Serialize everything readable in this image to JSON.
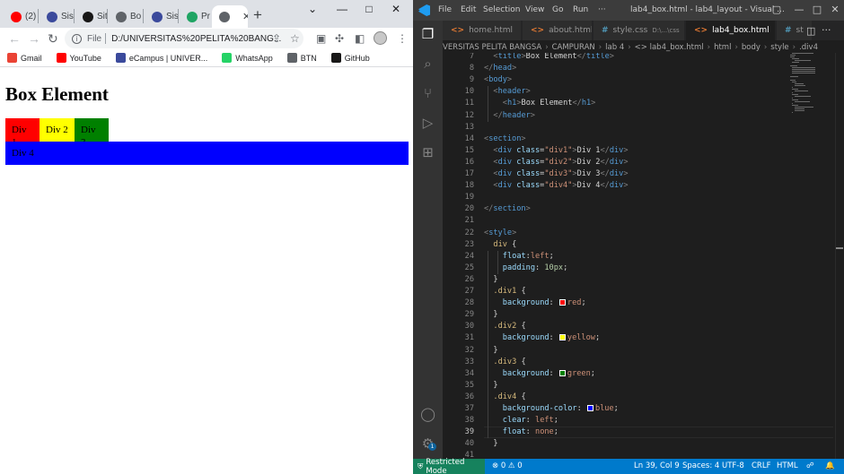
{
  "browser": {
    "tabs": [
      {
        "label": "(2)",
        "icon": "youtube-icon",
        "color": "#ff0000"
      },
      {
        "label": "Sis",
        "icon": "campus-icon",
        "color": "#3b4a9c"
      },
      {
        "label": "Sit",
        "icon": "github-icon",
        "color": "#181717"
      },
      {
        "label": "Bo",
        "icon": "globe-icon",
        "color": "#5f6368"
      },
      {
        "label": "Sis",
        "icon": "campus-icon",
        "color": "#3b4a9c"
      },
      {
        "label": "Pra",
        "icon": "drive-icon",
        "color": "#1fa463"
      },
      {
        "label": "",
        "icon": "globe-icon",
        "color": "#5f6368"
      }
    ],
    "new_tab": "+",
    "window_controls": {
      "minimize": "—",
      "maximize": "□",
      "close": "✕",
      "dropdown": "⌄"
    },
    "nav": {
      "back": "←",
      "forward": "→",
      "reload": "↻"
    },
    "address": {
      "scheme": "File",
      "url": "D:/UNIVERSITAS%20PELITA%20BANG..."
    },
    "bookmarks": [
      {
        "label": "Gmail",
        "icon": "gmail-icon",
        "color": "#ea4335"
      },
      {
        "label": "YouTube",
        "icon": "youtube-icon",
        "color": "#ff0000"
      },
      {
        "label": "eCampus | UNIVER...",
        "icon": "campus-icon",
        "color": "#3b4a9c"
      },
      {
        "label": "WhatsApp",
        "icon": "whatsapp-icon",
        "color": "#25d366"
      },
      {
        "label": "BTN",
        "icon": "globe-icon",
        "color": "#5f6368"
      },
      {
        "label": "GitHub",
        "icon": "github-icon",
        "color": "#181717"
      }
    ],
    "page": {
      "heading": "Box Element",
      "divs": [
        {
          "label": "Div 1",
          "color": "#ff0000"
        },
        {
          "label": "Div 2",
          "color": "#ffff00"
        },
        {
          "label": "Div 3",
          "color": "#008000"
        },
        {
          "label": "Div 4",
          "color": "#0000ff"
        }
      ]
    }
  },
  "vscode": {
    "menu": [
      "File",
      "Edit",
      "Selection",
      "View",
      "Go",
      "Run",
      "···"
    ],
    "title": "lab4_box.html - lab4_layout - Visual ...",
    "window_controls": {
      "layout": "▢",
      "minimize": "—",
      "maximize": "□",
      "close": "✕"
    },
    "tabs": [
      {
        "icon": "<>",
        "kind": "html",
        "label": "home.html",
        "desc": ""
      },
      {
        "icon": "<>",
        "kind": "html",
        "label": "about.html",
        "desc": ""
      },
      {
        "icon": "#",
        "kind": "css",
        "label": "style.css",
        "desc": "D:\\...\\css"
      },
      {
        "icon": "<>",
        "kind": "html",
        "label": "lab4_box.html",
        "desc": "",
        "active": true
      },
      {
        "icon": "#",
        "kind": "css",
        "label": "st",
        "desc": ""
      }
    ],
    "breadcrumb": [
      "VERSITAS PELITA BANGSA",
      "CAMPURAN",
      "lab 4",
      "<> lab4_box.html",
      "html",
      "body",
      "style",
      ".div4"
    ],
    "code": {
      "current_line": 39,
      "lines": [
        {
          "n": 7,
          "indent": 2,
          "tokens": [
            [
              "br",
              "<"
            ],
            [
              "tg",
              "title"
            ],
            [
              "br",
              ">"
            ],
            [
              "tx",
              "Box Element"
            ],
            [
              "br",
              "</"
            ],
            [
              "tg",
              "title"
            ],
            [
              "br",
              ">"
            ]
          ]
        },
        {
          "n": 8,
          "indent": 0,
          "tokens": [
            [
              "br",
              "</"
            ],
            [
              "tg",
              "head"
            ],
            [
              "br",
              ">"
            ]
          ]
        },
        {
          "n": 9,
          "indent": 0,
          "tokens": [
            [
              "br",
              "<"
            ],
            [
              "tg",
              "body"
            ],
            [
              "br",
              ">"
            ]
          ]
        },
        {
          "n": 10,
          "indent": 2,
          "tokens": [
            [
              "br",
              "<"
            ],
            [
              "tg",
              "header"
            ],
            [
              "br",
              ">"
            ]
          ]
        },
        {
          "n": 11,
          "indent": 4,
          "tokens": [
            [
              "br",
              "<"
            ],
            [
              "tg",
              "h1"
            ],
            [
              "br",
              ">"
            ],
            [
              "tx",
              "Box Element"
            ],
            [
              "br",
              "</"
            ],
            [
              "tg",
              "h1"
            ],
            [
              "br",
              ">"
            ]
          ]
        },
        {
          "n": 12,
          "indent": 2,
          "tokens": [
            [
              "br",
              "</"
            ],
            [
              "tg",
              "header"
            ],
            [
              "br",
              ">"
            ]
          ]
        },
        {
          "n": 13,
          "indent": 0,
          "tokens": []
        },
        {
          "n": 14,
          "indent": 0,
          "tokens": [
            [
              "br",
              "<"
            ],
            [
              "tg",
              "section"
            ],
            [
              "br",
              ">"
            ]
          ]
        },
        {
          "n": 15,
          "indent": 2,
          "tokens": [
            [
              "br",
              "<"
            ],
            [
              "tg",
              "div"
            ],
            [
              "tx",
              " "
            ],
            [
              "at",
              "class"
            ],
            [
              "tx",
              "="
            ],
            [
              "sv",
              "\"div1\""
            ],
            [
              "br",
              ">"
            ],
            [
              "tx",
              "Div 1"
            ],
            [
              "br",
              "</"
            ],
            [
              "tg",
              "div"
            ],
            [
              "br",
              ">"
            ]
          ]
        },
        {
          "n": 16,
          "indent": 2,
          "tokens": [
            [
              "br",
              "<"
            ],
            [
              "tg",
              "div"
            ],
            [
              "tx",
              " "
            ],
            [
              "at",
              "class"
            ],
            [
              "tx",
              "="
            ],
            [
              "sv",
              "\"div2\""
            ],
            [
              "br",
              ">"
            ],
            [
              "tx",
              "Div 2"
            ],
            [
              "br",
              "</"
            ],
            [
              "tg",
              "div"
            ],
            [
              "br",
              ">"
            ]
          ]
        },
        {
          "n": 17,
          "indent": 2,
          "tokens": [
            [
              "br",
              "<"
            ],
            [
              "tg",
              "div"
            ],
            [
              "tx",
              " "
            ],
            [
              "at",
              "class"
            ],
            [
              "tx",
              "="
            ],
            [
              "sv",
              "\"div3\""
            ],
            [
              "br",
              ">"
            ],
            [
              "tx",
              "Div 3"
            ],
            [
              "br",
              "</"
            ],
            [
              "tg",
              "div"
            ],
            [
              "br",
              ">"
            ]
          ]
        },
        {
          "n": 18,
          "indent": 2,
          "tokens": [
            [
              "br",
              "<"
            ],
            [
              "tg",
              "div"
            ],
            [
              "tx",
              " "
            ],
            [
              "at",
              "class"
            ],
            [
              "tx",
              "="
            ],
            [
              "sv",
              "\"div4\""
            ],
            [
              "br",
              ">"
            ],
            [
              "tx",
              "Div 4"
            ],
            [
              "br",
              "</"
            ],
            [
              "tg",
              "div"
            ],
            [
              "br",
              ">"
            ]
          ]
        },
        {
          "n": 19,
          "indent": 0,
          "tokens": []
        },
        {
          "n": 20,
          "indent": 0,
          "tokens": [
            [
              "br",
              "</"
            ],
            [
              "tg",
              "section"
            ],
            [
              "br",
              ">"
            ]
          ]
        },
        {
          "n": 21,
          "indent": 0,
          "tokens": []
        },
        {
          "n": 22,
          "indent": 0,
          "tokens": [
            [
              "br",
              "<"
            ],
            [
              "tg",
              "style"
            ],
            [
              "br",
              ">"
            ]
          ]
        },
        {
          "n": 23,
          "indent": 2,
          "tokens": [
            [
              "sel",
              "div"
            ],
            [
              "tx",
              " {"
            ]
          ]
        },
        {
          "n": 24,
          "indent": 4,
          "tokens": [
            [
              "pr",
              "float"
            ],
            [
              "tx",
              ":"
            ],
            [
              "vv",
              "left"
            ],
            [
              "tx",
              ";"
            ]
          ]
        },
        {
          "n": 25,
          "indent": 4,
          "tokens": [
            [
              "pr",
              "padding"
            ],
            [
              "tx",
              ": "
            ],
            [
              "nm",
              "10px"
            ],
            [
              "tx",
              ";"
            ]
          ]
        },
        {
          "n": 26,
          "indent": 2,
          "tokens": [
            [
              "tx",
              "}"
            ]
          ]
        },
        {
          "n": 27,
          "indent": 2,
          "tokens": [
            [
              "sel",
              ".div1"
            ],
            [
              "tx",
              " {"
            ]
          ]
        },
        {
          "n": 28,
          "indent": 4,
          "tokens": [
            [
              "pr",
              "background"
            ],
            [
              "tx",
              ": "
            ],
            [
              "sw",
              "#ff0000"
            ],
            [
              "vv",
              "red"
            ],
            [
              "tx",
              ";"
            ]
          ]
        },
        {
          "n": 29,
          "indent": 2,
          "tokens": [
            [
              "tx",
              "}"
            ]
          ]
        },
        {
          "n": 30,
          "indent": 2,
          "tokens": [
            [
              "sel",
              ".div2"
            ],
            [
              "tx",
              " {"
            ]
          ]
        },
        {
          "n": 31,
          "indent": 4,
          "tokens": [
            [
              "pr",
              "background"
            ],
            [
              "tx",
              ": "
            ],
            [
              "sw",
              "#ffff00"
            ],
            [
              "vv",
              "yellow"
            ],
            [
              "tx",
              ";"
            ]
          ]
        },
        {
          "n": 32,
          "indent": 2,
          "tokens": [
            [
              "tx",
              "}"
            ]
          ]
        },
        {
          "n": 33,
          "indent": 2,
          "tokens": [
            [
              "sel",
              ".div3"
            ],
            [
              "tx",
              " {"
            ]
          ]
        },
        {
          "n": 34,
          "indent": 4,
          "tokens": [
            [
              "pr",
              "background"
            ],
            [
              "tx",
              ": "
            ],
            [
              "sw",
              "#008000"
            ],
            [
              "vv",
              "green"
            ],
            [
              "tx",
              ";"
            ]
          ]
        },
        {
          "n": 35,
          "indent": 2,
          "tokens": [
            [
              "tx",
              "}"
            ]
          ]
        },
        {
          "n": 36,
          "indent": 2,
          "tokens": [
            [
              "sel",
              ".div4"
            ],
            [
              "tx",
              " {"
            ]
          ]
        },
        {
          "n": 37,
          "indent": 4,
          "tokens": [
            [
              "pr",
              "background-color"
            ],
            [
              "tx",
              ": "
            ],
            [
              "sw",
              "#0000ff"
            ],
            [
              "vv",
              "blue"
            ],
            [
              "tx",
              ";"
            ]
          ]
        },
        {
          "n": 38,
          "indent": 4,
          "tokens": [
            [
              "pr",
              "clear"
            ],
            [
              "tx",
              ": "
            ],
            [
              "vv",
              "left"
            ],
            [
              "tx",
              ";"
            ]
          ]
        },
        {
          "n": 39,
          "indent": 4,
          "tokens": [
            [
              "pr",
              "float"
            ],
            [
              "tx",
              ": "
            ],
            [
              "vv",
              "none"
            ],
            [
              "tx",
              ";"
            ]
          ]
        },
        {
          "n": 40,
          "indent": 2,
          "tokens": [
            [
              "tx",
              "}"
            ]
          ]
        },
        {
          "n": 41,
          "indent": 0,
          "tokens": []
        }
      ]
    },
    "status": {
      "restricted": "Restricted Mode",
      "problems": "⊗ 0 ⚠ 0",
      "position": "Ln 39, Col 9",
      "spaces": "Spaces: 4",
      "encoding": "UTF-8",
      "eol": "CRLF",
      "language": "HTML"
    },
    "accounts_badge": "1"
  }
}
